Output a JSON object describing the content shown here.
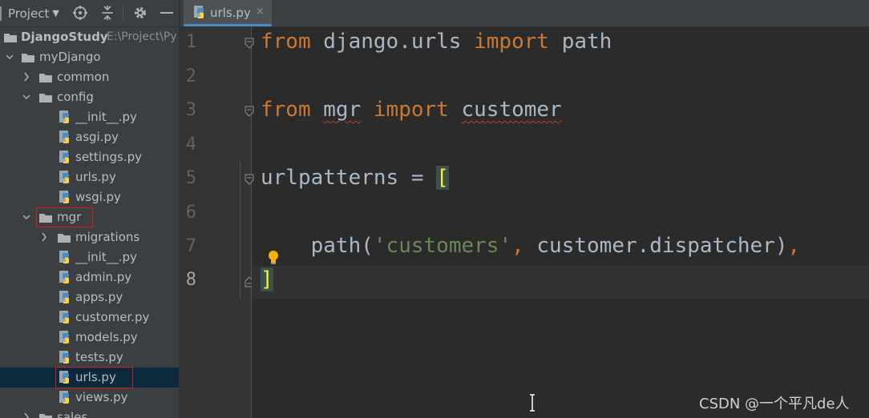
{
  "project_panel": {
    "title": "Project",
    "root": {
      "name": "DjangoStudy",
      "path": "E:\\Project\\Py"
    },
    "tree": [
      {
        "label": "myDjango"
      },
      {
        "label": "common"
      },
      {
        "label": "config"
      },
      {
        "label": "__init__.py"
      },
      {
        "label": "asgi.py"
      },
      {
        "label": "settings.py"
      },
      {
        "label": "urls.py"
      },
      {
        "label": "wsgi.py"
      },
      {
        "label": "mgr"
      },
      {
        "label": "migrations"
      },
      {
        "label": "__init__.py"
      },
      {
        "label": "admin.py"
      },
      {
        "label": "apps.py"
      },
      {
        "label": "customer.py"
      },
      {
        "label": "models.py"
      },
      {
        "label": "tests.py"
      },
      {
        "label": "urls.py"
      },
      {
        "label": "views.py"
      },
      {
        "label": "sales"
      }
    ]
  },
  "editor": {
    "tab": {
      "label": "urls.py",
      "close": "×"
    },
    "line_numbers": [
      "1",
      "2",
      "3",
      "4",
      "5",
      "6",
      "7",
      "8"
    ],
    "code": {
      "l1": {
        "kw1": "from",
        "mod": " django.urls ",
        "kw2": "import",
        "name": " path"
      },
      "l3": {
        "kw1": "from",
        "sp1": " ",
        "mod": "mgr",
        "sp2": " ",
        "kw2": "import",
        "sp3": " ",
        "name": "customer"
      },
      "l5": {
        "text": "urlpatterns = ",
        "bracket": "["
      },
      "l7": {
        "indent": "    ",
        "fn": "path(",
        "str": "'customers'",
        "comma1": ",",
        "rest": " customer.dispatcher)",
        "comma2": ","
      },
      "l8": {
        "bracket": "]"
      }
    }
  },
  "watermark": "CSDN @一个平凡de人",
  "colors": {
    "keyword": "#cc7832",
    "string": "#6a8759",
    "text": "#a9b7c6",
    "highlight_box": "#d11f1f",
    "selection": "#0d293e"
  }
}
